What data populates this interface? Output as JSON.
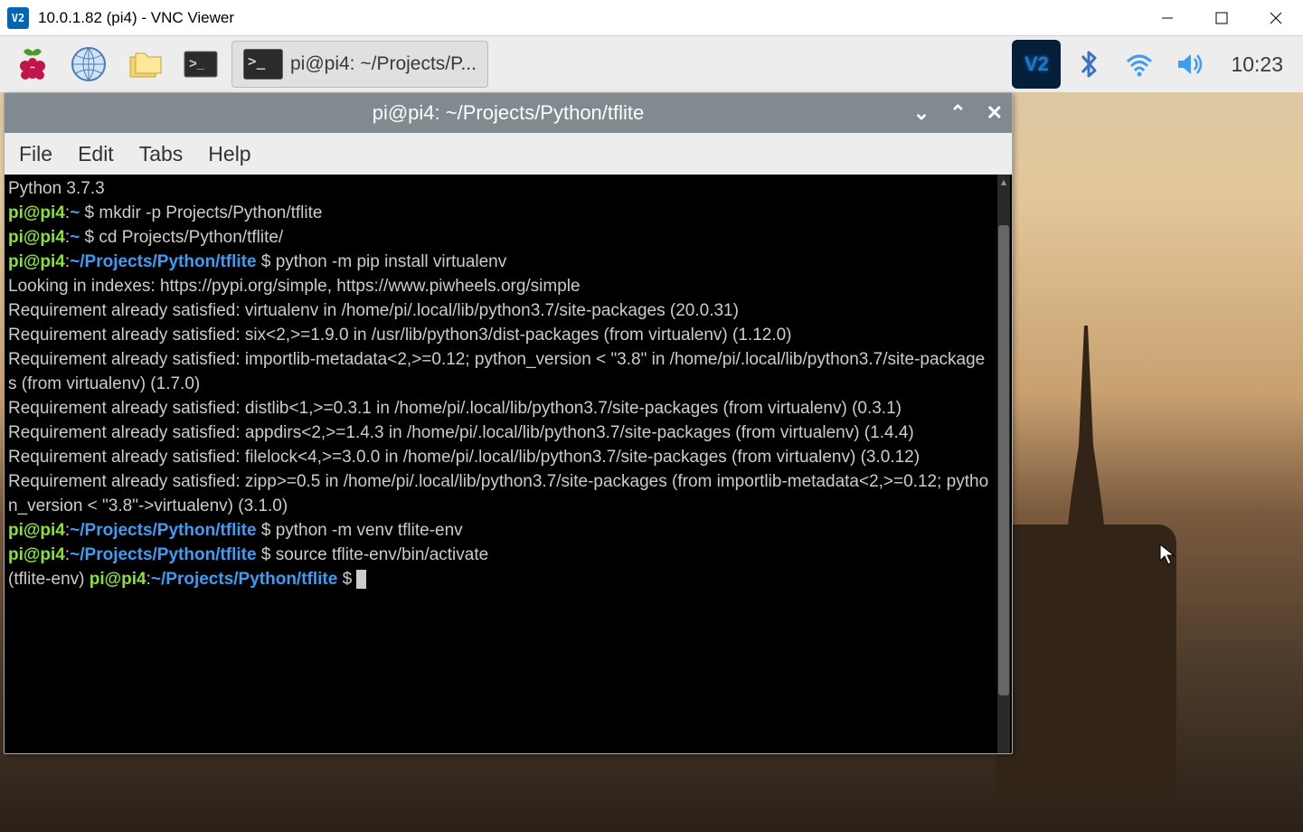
{
  "windows_title": "10.0.1.82 (pi4) - VNC Viewer",
  "vnc_app_badge": "V2",
  "pi_task_button_label": "pi@pi4: ~/Projects/P...",
  "clock": "10:23",
  "vnc_server_badge": "V2",
  "terminal": {
    "title": "pi@pi4: ~/Projects/Python/tflite",
    "menu": [
      "File",
      "Edit",
      "Tabs",
      "Help"
    ],
    "lines": [
      {
        "t": "plain",
        "text": "Python 3.7.3"
      },
      {
        "t": "prompt",
        "user": "pi@pi4",
        "path": "~",
        "cmd": "mkdir -p Projects/Python/tflite"
      },
      {
        "t": "prompt",
        "user": "pi@pi4",
        "path": "~",
        "cmd": "cd Projects/Python/tflite/"
      },
      {
        "t": "prompt",
        "user": "pi@pi4",
        "path": "~/Projects/Python/tflite",
        "cmd": "python -m pip install virtualenv"
      },
      {
        "t": "plain",
        "text": "Looking in indexes: https://pypi.org/simple, https://www.piwheels.org/simple"
      },
      {
        "t": "plain",
        "text": "Requirement already satisfied: virtualenv in /home/pi/.local/lib/python3.7/site-packages (20.0.31)"
      },
      {
        "t": "plain",
        "text": "Requirement already satisfied: six<2,>=1.9.0 in /usr/lib/python3/dist-packages (from virtualenv) (1.12.0)"
      },
      {
        "t": "plain",
        "text": "Requirement already satisfied: importlib-metadata<2,>=0.12; python_version < \"3.8\" in /home/pi/.local/lib/python3.7/site-packages (from virtualenv) (1.7.0)"
      },
      {
        "t": "plain",
        "text": "Requirement already satisfied: distlib<1,>=0.3.1 in /home/pi/.local/lib/python3.7/site-packages (from virtualenv) (0.3.1)"
      },
      {
        "t": "plain",
        "text": "Requirement already satisfied: appdirs<2,>=1.4.3 in /home/pi/.local/lib/python3.7/site-packages (from virtualenv) (1.4.4)"
      },
      {
        "t": "plain",
        "text": "Requirement already satisfied: filelock<4,>=3.0.0 in /home/pi/.local/lib/python3.7/site-packages (from virtualenv) (3.0.12)"
      },
      {
        "t": "plain",
        "text": "Requirement already satisfied: zipp>=0.5 in /home/pi/.local/lib/python3.7/site-packages (from importlib-metadata<2,>=0.12; python_version < \"3.8\"->virtualenv) (3.1.0)"
      },
      {
        "t": "prompt",
        "user": "pi@pi4",
        "path": "~/Projects/Python/tflite",
        "cmd": "python -m venv tflite-env"
      },
      {
        "t": "prompt",
        "user": "pi@pi4",
        "path": "~/Projects/Python/tflite",
        "cmd": "source tflite-env/bin/activate"
      },
      {
        "t": "prompt",
        "venv": "(tflite-env) ",
        "user": "pi@pi4",
        "path": "~/Projects/Python/tflite",
        "cmd": "",
        "cursor": true
      }
    ]
  },
  "window_controls": {
    "down": "⌄",
    "up": "⌃",
    "close": "✕"
  }
}
